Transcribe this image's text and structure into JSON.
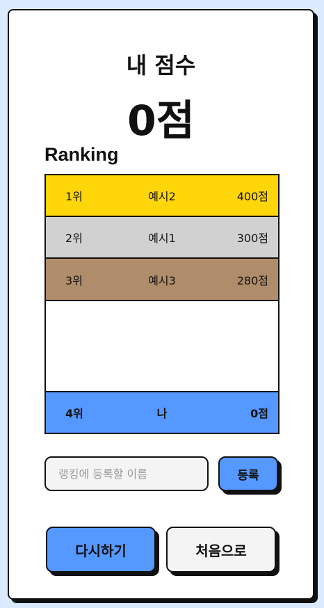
{
  "my_score": {
    "label": "내 점수",
    "value": "0점"
  },
  "ranking": {
    "title": "Ranking",
    "rows": [
      {
        "rank": "1위",
        "name": "예시2",
        "score": "400점",
        "color": "#ffd60a"
      },
      {
        "rank": "2위",
        "name": "예시1",
        "score": "300점",
        "color": "#d1d1d1"
      },
      {
        "rank": "3위",
        "name": "예시3",
        "score": "280점",
        "color": "#b08d6a"
      }
    ],
    "me": {
      "rank": "4위",
      "name": "나",
      "score": "0점",
      "color": "#5598ff"
    }
  },
  "register": {
    "input_placeholder": "랭킹에 등록할 이름",
    "input_value": "",
    "button_label": "등록"
  },
  "actions": {
    "retry_label": "다시하기",
    "home_label": "처음으로"
  },
  "colors": {
    "background": "#dceaff",
    "accent": "#5598ff"
  }
}
